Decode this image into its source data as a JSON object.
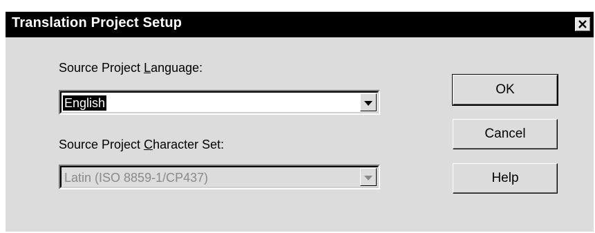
{
  "dialog": {
    "title": "Translation Project Setup",
    "close_icon": "close-x-icon"
  },
  "source_language": {
    "label_prefix": "Source Project ",
    "label_accel": "L",
    "label_suffix": "anguage:",
    "value": "English",
    "enabled": true
  },
  "character_set": {
    "label_prefix": "Source Project ",
    "label_accel": "C",
    "label_suffix": "haracter Set:",
    "value": "Latin (ISO 8859-1/CP437)",
    "enabled": false
  },
  "buttons": {
    "ok": "OK",
    "cancel": "Cancel",
    "help": "Help"
  },
  "colors": {
    "title_bar": "#000000",
    "face": "#dcdcdc",
    "selection": "#000000",
    "disabled_text": "#8a8a8a"
  }
}
